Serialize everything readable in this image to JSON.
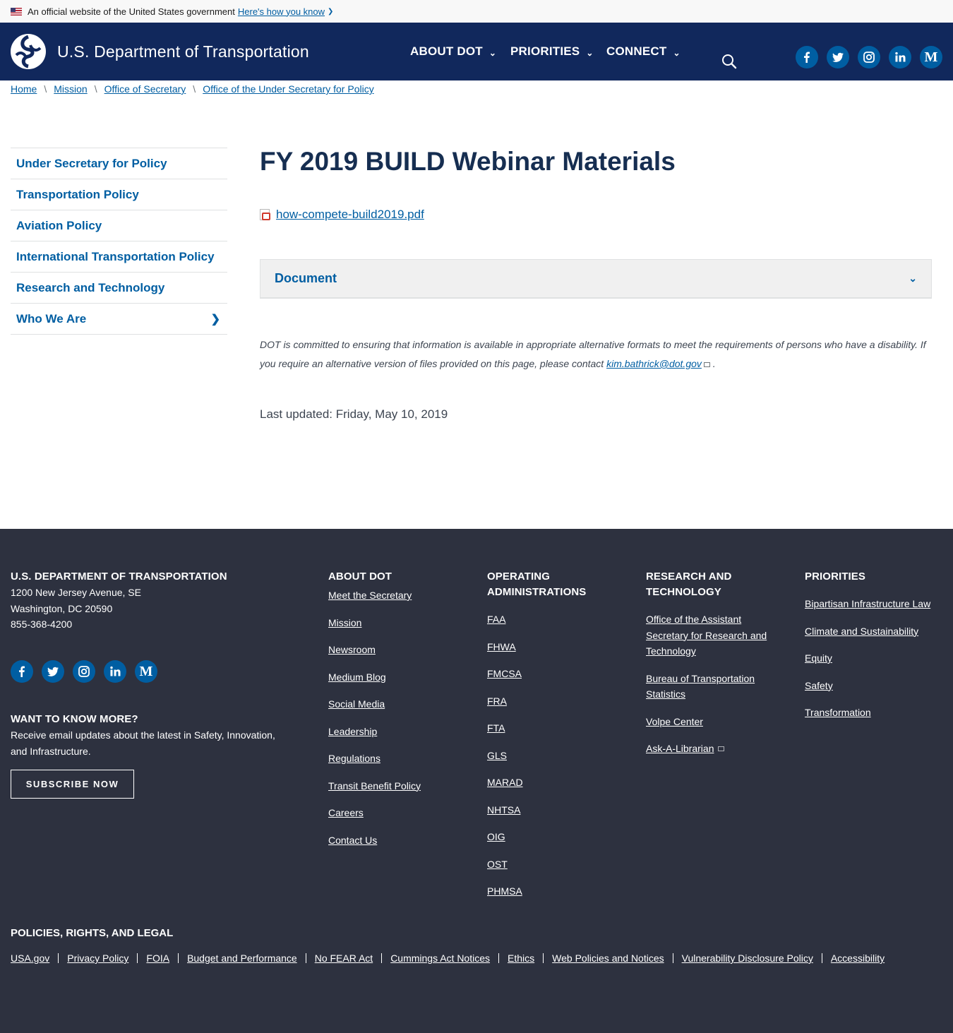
{
  "banner": {
    "text": "An official website of the United States government",
    "link": "Here's how you know"
  },
  "header": {
    "logo_text": "U.S. Department of Transportation",
    "nav": [
      "ABOUT DOT",
      "PRIORITIES",
      "CONNECT"
    ],
    "social": [
      "facebook-icon",
      "twitter-icon",
      "instagram-icon",
      "linkedin-icon",
      "medium-icon"
    ],
    "accent": "#11285c"
  },
  "breadcrumb": [
    "Home",
    "Mission",
    "Office of Secretary",
    "Office of the Under Secretary for Policy"
  ],
  "sidebar": {
    "items": [
      "Under Secretary for Policy",
      "Transportation Policy",
      "Aviation Policy",
      "International Transportation Policy",
      "Research and Technology",
      "Who We Are"
    ]
  },
  "main": {
    "title": "FY 2019 BUILD Webinar Materials",
    "file": "how-compete-build2019.pdf",
    "accordion_label": "Document",
    "notice_text": "DOT is committed to ensuring that information is available in appropriate alternative formats to meet the requirements of persons who have a disability. If you require an alternative version of files provided on this page, please contact",
    "notice_email": "kim.bathrick@dot.gov",
    "notice_end": ".",
    "last_updated": "Last updated: Friday, May 10, 2019"
  },
  "footer": {
    "org": {
      "heading": "U.S. DEPARTMENT OF TRANSPORTATION",
      "address1": "1200 New Jersey Avenue, SE",
      "address2": "Washington, DC 20590",
      "phone": "855-368-4200"
    },
    "want": {
      "heading": "WANT TO KNOW MORE?",
      "text": "Receive email updates about the latest in Safety, Innovation, and Infrastructure.",
      "button": "SUBSCRIBE NOW"
    },
    "about": {
      "heading": "ABOUT DOT",
      "links": [
        "Meet the Secretary",
        "Mission",
        "Newsroom",
        "Medium Blog",
        "Social Media",
        "Leadership",
        "Regulations",
        "Transit Benefit Policy",
        "Careers",
        "Contact Us"
      ]
    },
    "operating": {
      "heading": "OPERATING ADMINISTRATIONS",
      "links": [
        "FAA",
        "FHWA",
        "FMCSA",
        "FRA",
        "FTA",
        "GLS",
        "MARAD",
        "NHTSA",
        "OIG",
        "OST",
        "PHMSA"
      ]
    },
    "research": {
      "heading": "RESEARCH AND TECHNOLOGY",
      "links": [
        "Office of the Assistant Secretary for Research and Technology",
        "Bureau of Transportation Statistics",
        "Volpe Center",
        "Ask-A-Librarian"
      ]
    },
    "priorities": {
      "heading": "PRIORITIES",
      "links": [
        "Bipartisan Infrastructure Law",
        "Climate and Sustainability",
        "Equity",
        "Safety",
        "Transformation"
      ]
    },
    "legal": {
      "heading": "POLICIES, RIGHTS, AND LEGAL",
      "links": [
        "USA.gov",
        "Privacy Policy",
        "FOIA",
        "Budget and Performance",
        "No FEAR Act",
        "Cummings Act Notices",
        "Ethics",
        "Web Policies and Notices",
        "Vulnerability Disclosure Policy",
        "Accessibility"
      ]
    },
    "background": "#2d313f"
  }
}
